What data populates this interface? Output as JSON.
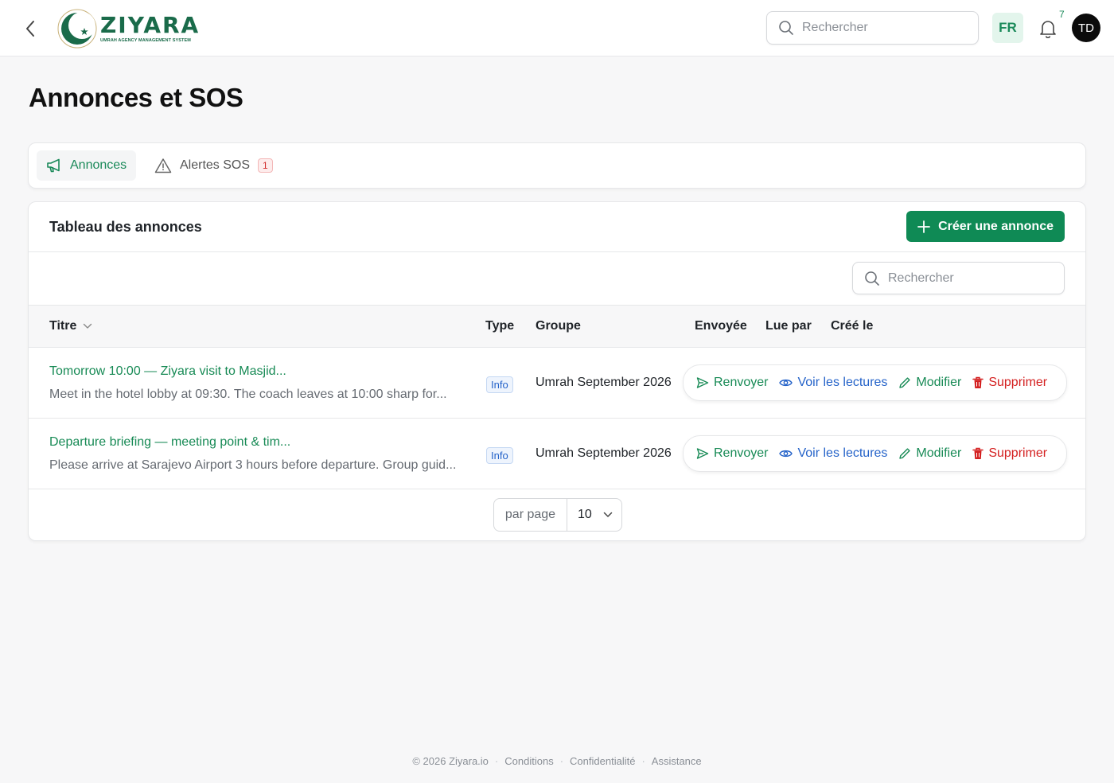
{
  "header": {
    "logo_name": "ZIYARA",
    "logo_subtitle": "UMRAH AGENCY MANAGEMENT SYSTEM",
    "search_placeholder": "Rechercher",
    "language": "FR",
    "notifications_count": "7",
    "avatar_initials": "TD"
  },
  "page": {
    "title": "Annonces et SOS"
  },
  "tabs": [
    {
      "label": "Annonces",
      "active": true
    },
    {
      "label": "Alertes SOS",
      "badge": "1"
    }
  ],
  "table": {
    "title": "Tableau des annonces",
    "create_label": "Créer une annonce",
    "search_placeholder": "Rechercher",
    "columns": [
      "Titre",
      "Type",
      "Groupe",
      "Envoyée",
      "Lue par",
      "Créé le"
    ],
    "rows": [
      {
        "title": "Tomorrow 10:00 — Ziyara visit to Masjid...",
        "description": "Meet in the hotel lobby at 09:30. The coach leaves at 10:00 sharp for...",
        "type": "Info",
        "group": "Umrah September 2026"
      },
      {
        "title": "Departure briefing — meeting point & tim...",
        "description": "Please arrive at Sarajevo Airport 3 hours before departure. Group guid...",
        "type": "Info",
        "group": "Umrah September 2026"
      }
    ],
    "actions": {
      "resend": "Renvoyer",
      "view_reads": "Voir les lectures",
      "edit": "Modifier",
      "delete": "Supprimer"
    },
    "pager": {
      "label": "par page",
      "value": "10"
    }
  },
  "footer": {
    "copyright": "© 2026 Ziyara.io",
    "links": [
      "Conditions",
      "Confidentialité",
      "Assistance"
    ]
  },
  "colors": {
    "brand_green": "#0f8a55",
    "link_blue": "#2563c9",
    "danger_red": "#d42020"
  }
}
